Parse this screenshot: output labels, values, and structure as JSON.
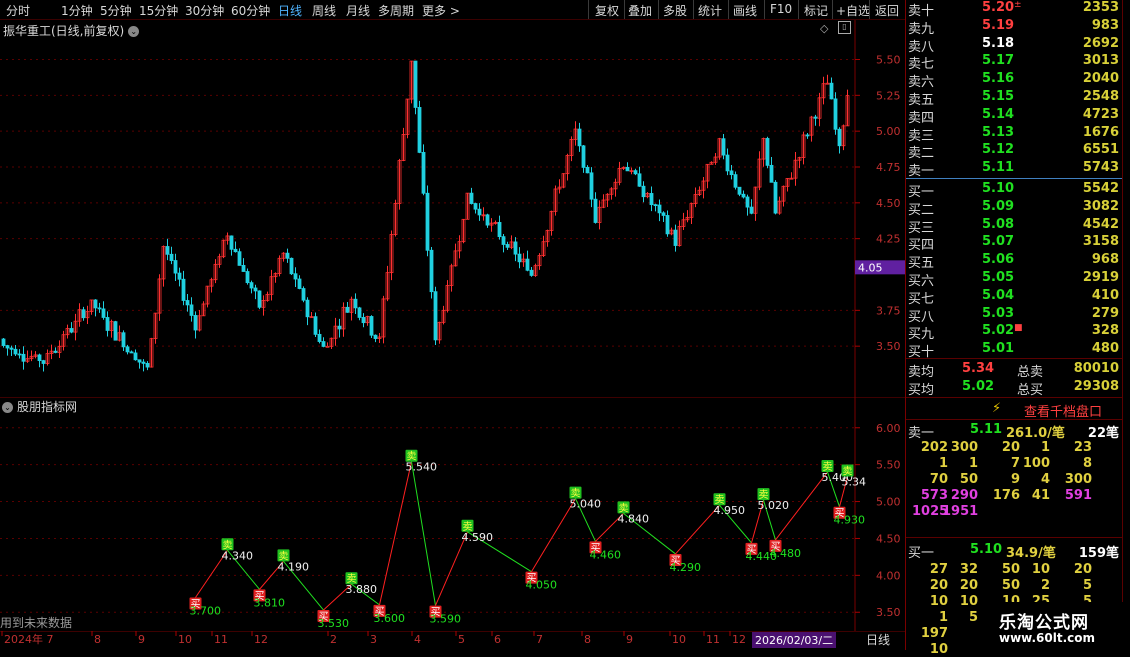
{
  "toolbar": {
    "periods": [
      "分时",
      "1分钟",
      "5分钟",
      "15分钟",
      "30分钟",
      "60分钟",
      "日线",
      "周线",
      "月线",
      "多周期",
      "更多 >"
    ],
    "active_period": "日线",
    "actions": [
      "复权",
      "叠加",
      "多股",
      "统计",
      "画线",
      "F10",
      "标记",
      "+自选",
      "返回"
    ]
  },
  "main_chart": {
    "title": "振华重工(日线,前复权)",
    "y_ticks": [
      "5.50",
      "5.25",
      "5.00",
      "4.75",
      "4.50",
      "4.25",
      "3.75",
      "3.50"
    ],
    "current_price_tag": "4.05",
    "ylim": [
      3.25,
      5.65
    ]
  },
  "indicator": {
    "title": "股朋指标网",
    "y_ticks": [
      "6.00",
      "5.50",
      "5.00",
      "4.50",
      "4.00",
      "3.50"
    ],
    "footer_note": "用到未来数据",
    "ylim": [
      3.3,
      6.2
    ],
    "top_label": "卖",
    "bottom_label": "买",
    "points": [
      {
        "type": "low",
        "label": "3.700",
        "value": 3.7,
        "day": 48
      },
      {
        "type": "high",
        "label": "4.340",
        "value": 4.34,
        "day": 56
      },
      {
        "type": "low",
        "label": "3.810",
        "value": 3.81,
        "day": 64
      },
      {
        "type": "high",
        "label": "4.190",
        "value": 4.19,
        "day": 70
      },
      {
        "type": "low",
        "label": "3.530",
        "value": 3.53,
        "day": 80
      },
      {
        "type": "high",
        "label": "3.880",
        "value": 3.88,
        "day": 87
      },
      {
        "type": "low",
        "label": "3.600",
        "value": 3.6,
        "day": 94
      },
      {
        "type": "high",
        "label": "5.540",
        "value": 5.54,
        "day": 102
      },
      {
        "type": "low",
        "label": "3.590",
        "value": 3.59,
        "day": 108
      },
      {
        "type": "high",
        "label": "4.590",
        "value": 4.59,
        "day": 116
      },
      {
        "type": "low",
        "label": "4.050",
        "value": 4.05,
        "day": 132
      },
      {
        "type": "high",
        "label": "5.040",
        "value": 5.04,
        "day": 143
      },
      {
        "type": "low",
        "label": "4.460",
        "value": 4.46,
        "day": 148
      },
      {
        "type": "high",
        "label": "4.840",
        "value": 4.84,
        "day": 155
      },
      {
        "type": "low",
        "label": "4.290",
        "value": 4.29,
        "day": 168
      },
      {
        "type": "high",
        "label": "4.950",
        "value": 4.95,
        "day": 179
      },
      {
        "type": "low",
        "label": "4.440",
        "value": 4.44,
        "day": 187
      },
      {
        "type": "high",
        "label": "5.020",
        "value": 5.02,
        "day": 190
      },
      {
        "type": "low",
        "label": "4.480",
        "value": 4.48,
        "day": 193
      },
      {
        "type": "high",
        "label": "5.400",
        "value": 5.4,
        "day": 206
      },
      {
        "type": "low",
        "label": "4.930",
        "value": 4.93,
        "day": 209
      },
      {
        "type": "high",
        "label": "5.34",
        "value": 5.34,
        "day": 211
      }
    ]
  },
  "x_axis": {
    "labels": [
      "2024年 7",
      "8",
      "9",
      "10",
      "11",
      "12",
      "2",
      "3",
      "4",
      "5",
      "6",
      "7",
      "8",
      "9",
      "10",
      "11",
      "12"
    ],
    "cursor_date": "2026/02/03/二",
    "period_label": "日线"
  },
  "orderbook": {
    "asks": [
      {
        "label": "卖十",
        "price": "5.20",
        "vol": "2353",
        "pc": "up",
        "flag": "±"
      },
      {
        "label": "卖九",
        "price": "5.19",
        "vol": "983",
        "pc": "up"
      },
      {
        "label": "卖八",
        "price": "5.18",
        "vol": "2692",
        "pc": "wh"
      },
      {
        "label": "卖七",
        "price": "5.17",
        "vol": "3013",
        "pc": "dn"
      },
      {
        "label": "卖六",
        "price": "5.16",
        "vol": "2040",
        "pc": "dn"
      },
      {
        "label": "卖五",
        "price": "5.15",
        "vol": "2548",
        "pc": "dn"
      },
      {
        "label": "卖四",
        "price": "5.14",
        "vol": "4723",
        "pc": "dn"
      },
      {
        "label": "卖三",
        "price": "5.13",
        "vol": "1676",
        "pc": "dn"
      },
      {
        "label": "卖二",
        "price": "5.12",
        "vol": "6551",
        "pc": "dn"
      },
      {
        "label": "卖一",
        "price": "5.11",
        "vol": "5743",
        "pc": "dn"
      }
    ],
    "bids": [
      {
        "label": "买一",
        "price": "5.10",
        "vol": "5542",
        "pc": "dn"
      },
      {
        "label": "买二",
        "price": "5.09",
        "vol": "3082",
        "pc": "dn"
      },
      {
        "label": "买三",
        "price": "5.08",
        "vol": "4542",
        "pc": "dn"
      },
      {
        "label": "买四",
        "price": "5.07",
        "vol": "3158",
        "pc": "dn"
      },
      {
        "label": "买五",
        "price": "5.06",
        "vol": "968",
        "pc": "dn"
      },
      {
        "label": "买六",
        "price": "5.05",
        "vol": "2919",
        "pc": "dn"
      },
      {
        "label": "买七",
        "price": "5.04",
        "vol": "410",
        "pc": "dn"
      },
      {
        "label": "买八",
        "price": "5.03",
        "vol": "279",
        "pc": "dn"
      },
      {
        "label": "买九",
        "price": "5.02",
        "vol": "328",
        "pc": "dn",
        "flag": "■"
      },
      {
        "label": "买十",
        "price": "5.01",
        "vol": "480",
        "pc": "dn"
      }
    ],
    "avg_sell_label": "卖均",
    "avg_sell": "5.34",
    "total_sell_label": "总卖",
    "total_sell": "80010",
    "avg_buy_label": "买均",
    "avg_buy": "5.02",
    "total_buy_label": "总买",
    "total_buy": "29308"
  },
  "detail": {
    "button_label": "查看千档盘口",
    "sell1_label": "卖一",
    "sell1_price": "5.11",
    "sell1_vol": "261.0/笔",
    "sell1_count": "22笔",
    "sell_queue": [
      [
        "202",
        "300",
        "20",
        "1",
        "23"
      ],
      [
        "1",
        "1",
        "7",
        "100",
        "8"
      ],
      [
        "70",
        "50",
        "9",
        "4",
        "300"
      ],
      [
        "573",
        "290",
        "176",
        "41",
        "591"
      ],
      [
        "1025",
        "1951",
        "",
        "",
        ""
      ]
    ],
    "buy1_label": "买一",
    "buy1_price": "5.10",
    "buy1_vol": "34.9/笔",
    "buy1_count": "159笔",
    "buy_queue": [
      [
        "27",
        "32",
        "50",
        "10",
        "20"
      ],
      [
        "20",
        "20",
        "50",
        "2",
        "5"
      ],
      [
        "10",
        "10",
        "10",
        "25",
        "5"
      ],
      [
        "1",
        "5",
        "",
        "",
        ""
      ],
      [
        "197",
        "",
        "",
        "",
        ""
      ],
      [
        "10",
        "",
        "",
        "",
        ""
      ]
    ]
  },
  "watermark": {
    "line1": "乐淘公式网",
    "line2": "www.60lt.com"
  },
  "colors": {
    "up": "#ff3030",
    "down": "#20d0e0",
    "zig_up": "#ff2020",
    "zig_down": "#20e020",
    "grid": "#5a0000"
  }
}
